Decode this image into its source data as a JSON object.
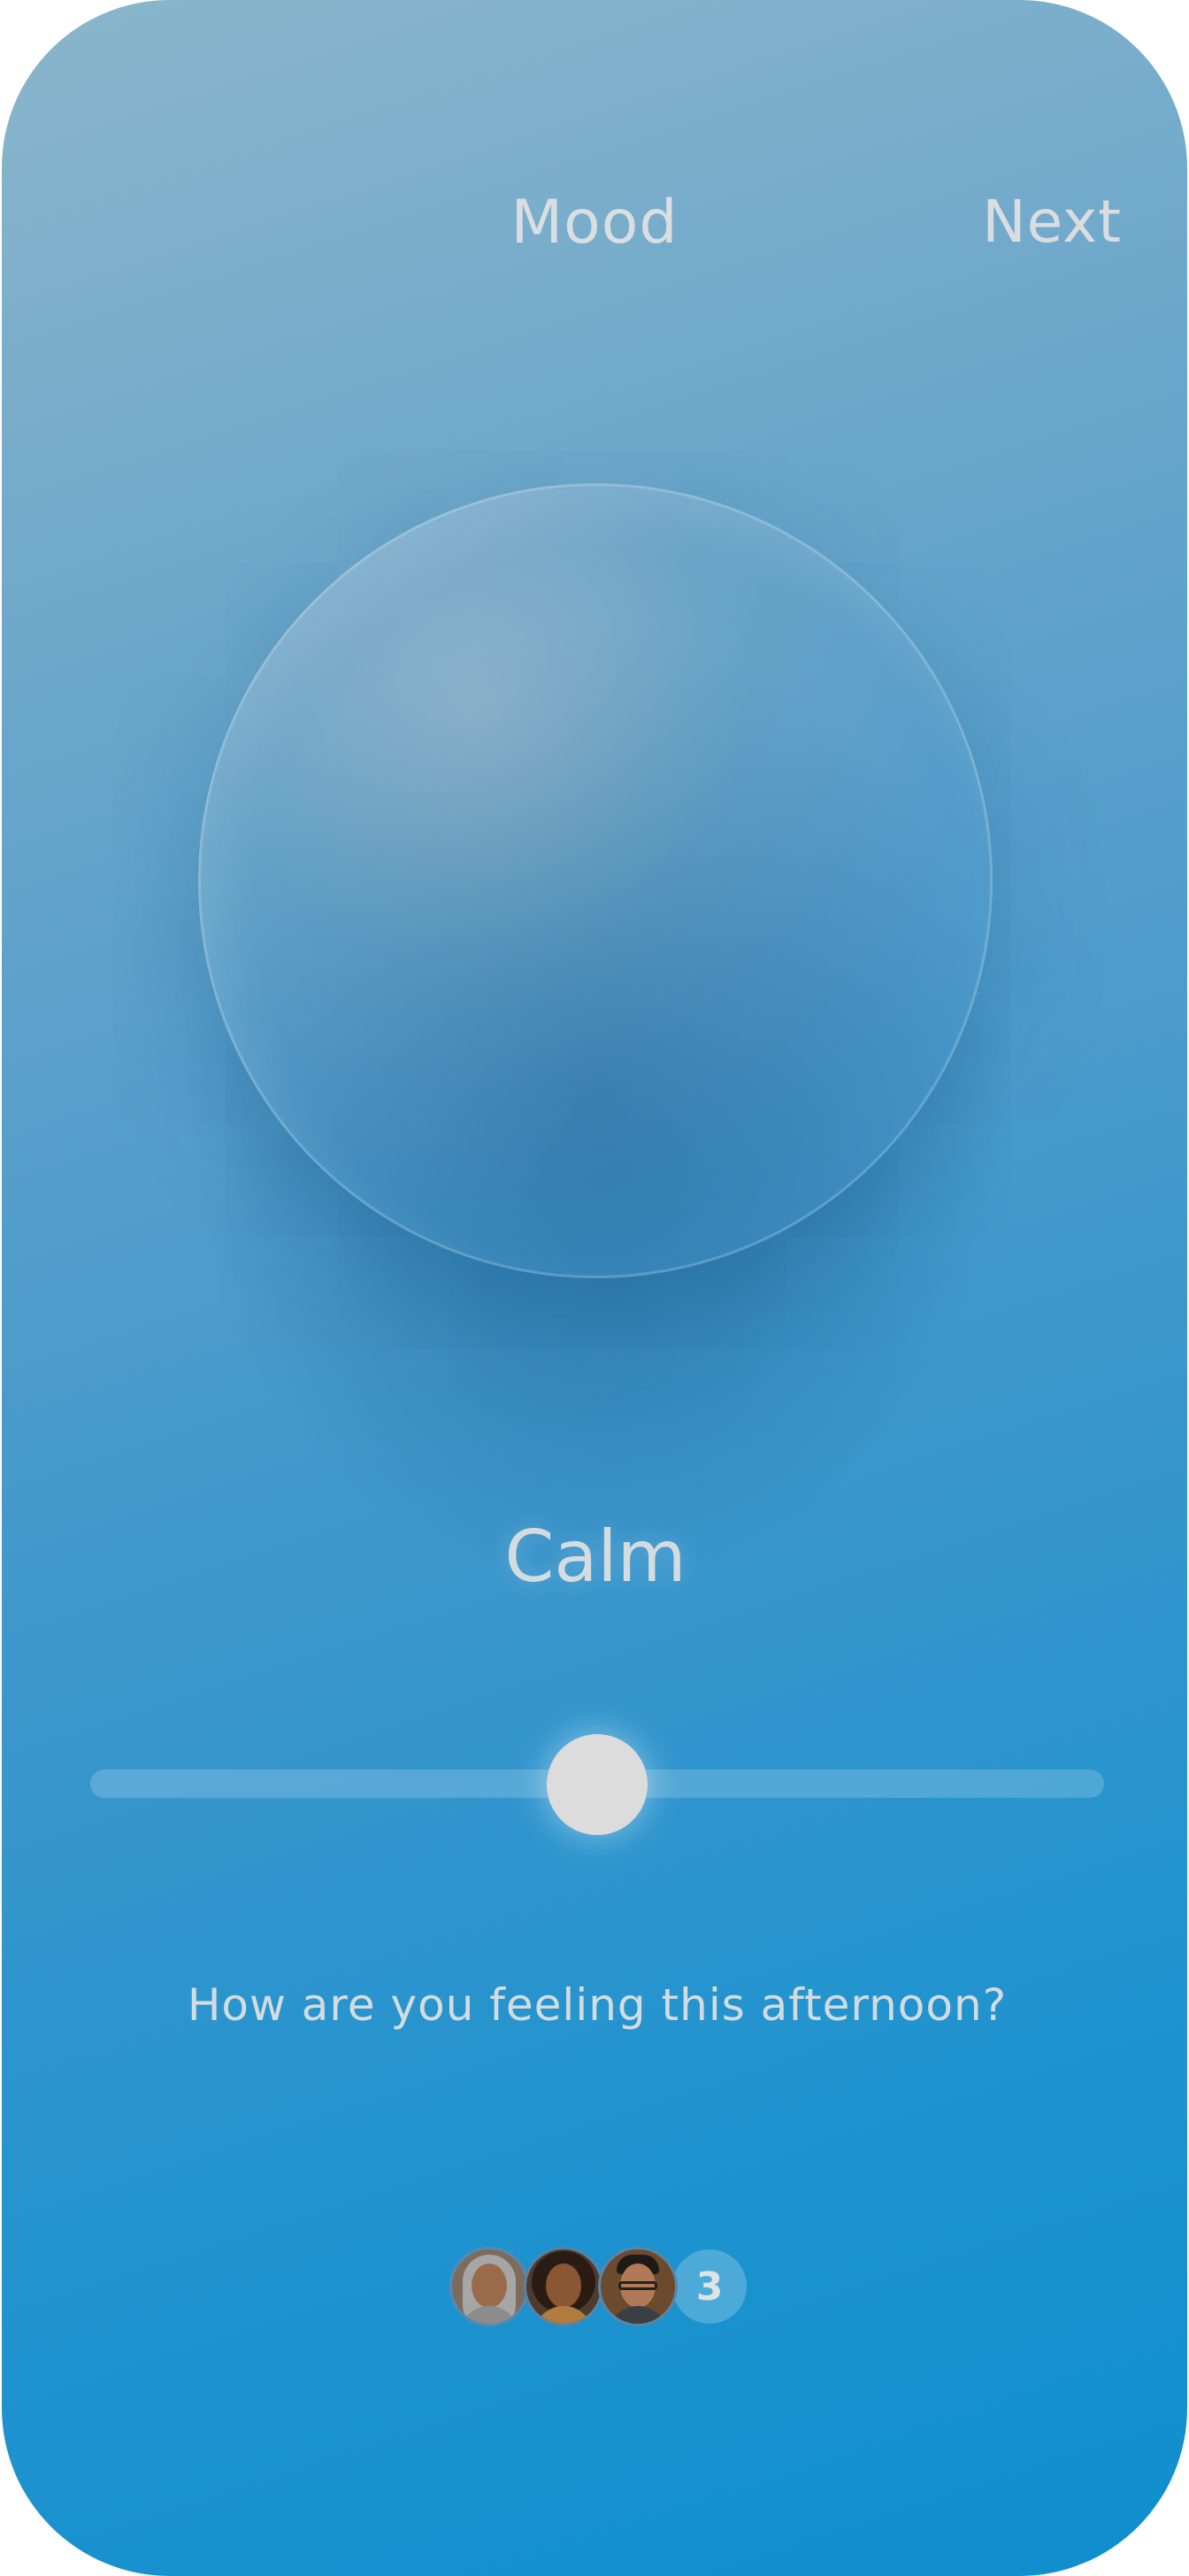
{
  "header": {
    "title": "Mood",
    "next_label": "Next"
  },
  "mood": {
    "label": "Calm",
    "slider_value_fraction": 0.5
  },
  "prompt": {
    "question": "How are you feeling this afternoon?"
  },
  "participants": {
    "avatars": [
      "avatar-woman-hijab",
      "avatar-woman-curly-hair",
      "avatar-man-glasses"
    ],
    "count": "3"
  },
  "colors": {
    "gradient_top": "#8bb6cb",
    "gradient_bottom": "#0f8ecd",
    "text": "#e2e2e2",
    "slider_thumb": "#dcdcdc"
  }
}
